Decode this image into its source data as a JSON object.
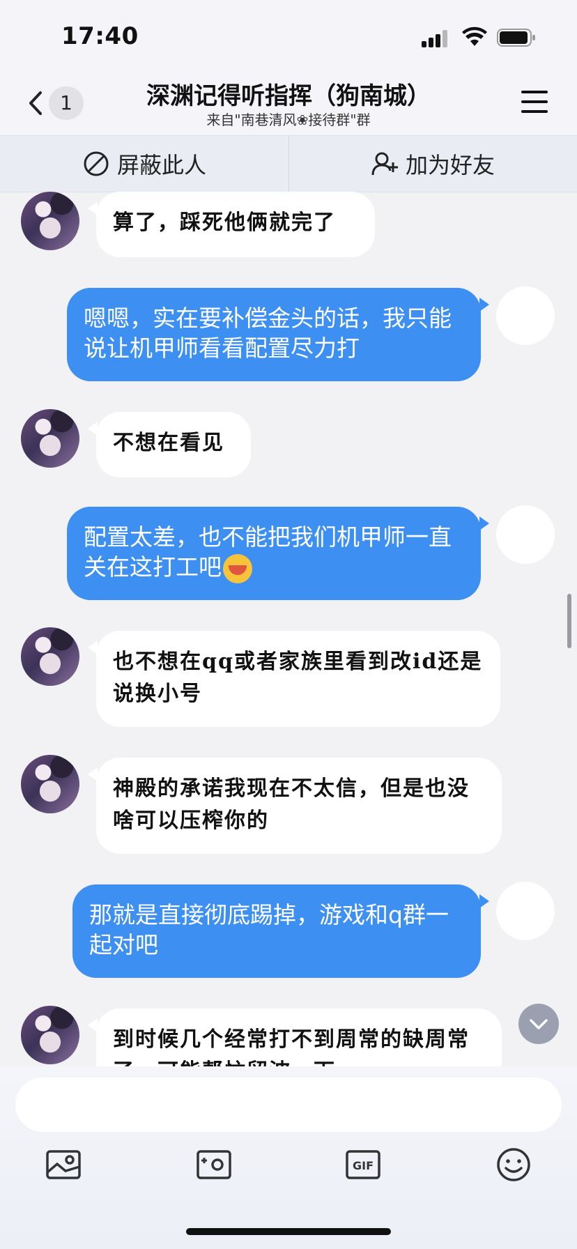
{
  "status_bar": {
    "time": "17:40"
  },
  "header": {
    "unread_count": "1",
    "title": "深渊记得听指挥（狗南城）",
    "subtitle": "来自\"南巷清风❀接待群\"群"
  },
  "actions": {
    "block_label": "屏蔽此人",
    "add_friend_label": "加为好友"
  },
  "messages": [
    {
      "side": "left",
      "text": "算了，踩死他俩就完了"
    },
    {
      "side": "right",
      "text": "嗯嗯，实在要补偿金头的话，我只能说让机甲师看看配置尽力打"
    },
    {
      "side": "left",
      "text": "不想在看见"
    },
    {
      "side": "right",
      "text": "配置太差，也不能把我们机甲师一直关在这打工吧"
    },
    {
      "side": "left",
      "text": "也不想在qq或者家族里看到改id还是说换小号"
    },
    {
      "side": "left",
      "text": "神殿的承诺我现在不太信，但是也没啥可以压榨你的"
    },
    {
      "side": "right",
      "text": "那就是直接彻底踢掉，游戏和q群一起对吧"
    },
    {
      "side": "left",
      "text": "到时候几个经常打不到周常的缺周常了，可能帮忙留波一下"
    }
  ],
  "input": {
    "placeholder": ""
  },
  "toolbar": {
    "icons": [
      "image-icon",
      "camera-icon",
      "gif-icon",
      "emoji-icon"
    ]
  },
  "colors": {
    "bubble_mine": "#3d8ff2",
    "bubble_other": "#ffffff",
    "background": "#f2f2f4"
  }
}
